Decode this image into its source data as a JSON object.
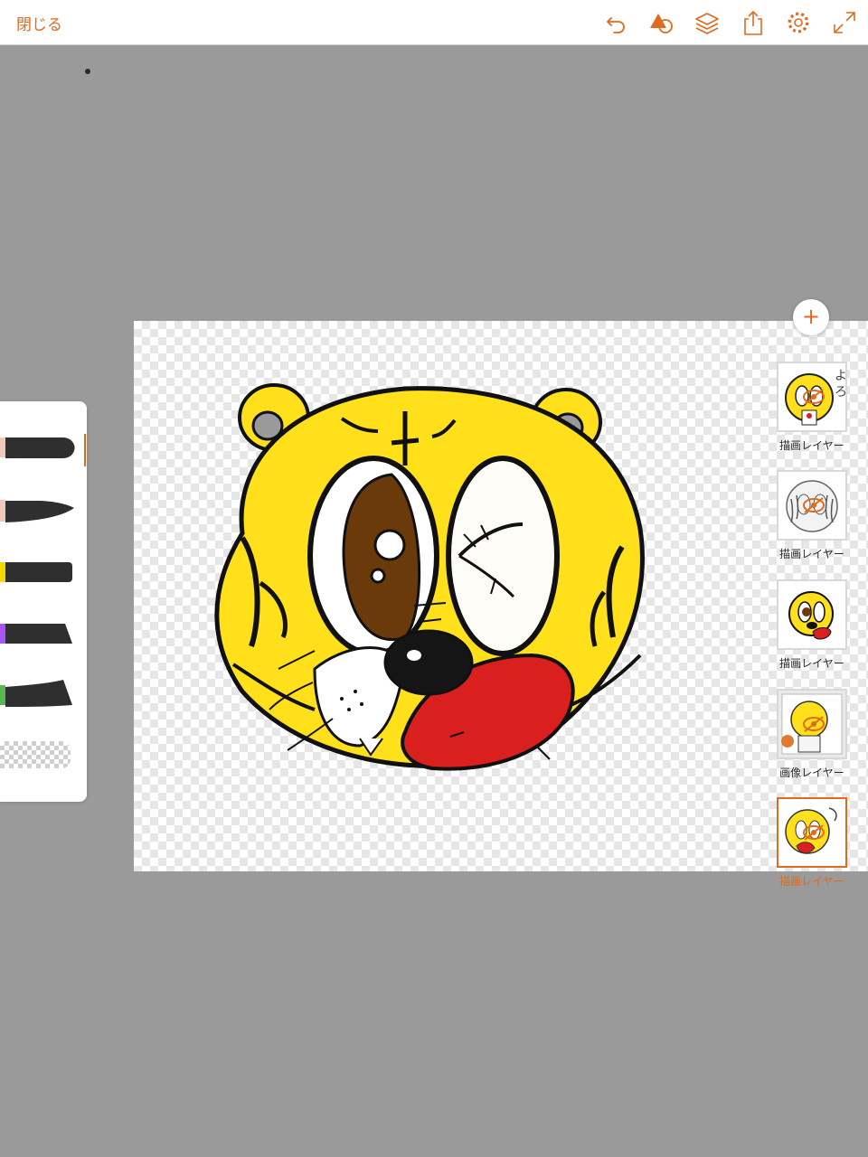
{
  "topbar": {
    "close_label": "閉じる",
    "tools": [
      {
        "icon": "undo-icon"
      },
      {
        "icon": "shapes-icon"
      },
      {
        "icon": "layers-icon"
      },
      {
        "icon": "share-icon"
      },
      {
        "icon": "gear-icon"
      },
      {
        "icon": "fullscreen-icon"
      }
    ]
  },
  "colors": {
    "accent": "#e06a1e",
    "background": "#9a9a9a",
    "tiger_yellow": "#ffe01a",
    "eye_brown": "#6b3a0a",
    "tongue_red": "#d9201f"
  },
  "brushes": [
    {
      "name": "round-brush",
      "swatch": "#f2c9b8"
    },
    {
      "name": "tapered-brush",
      "swatch": "#f2c9b8"
    },
    {
      "name": "flat-brush",
      "swatch": "#f5d800"
    },
    {
      "name": "chisel-brush",
      "swatch": "#a855f7"
    },
    {
      "name": "fan-brush",
      "swatch": "#5bb850"
    }
  ],
  "layers": {
    "add_label": "+",
    "items": [
      {
        "label": "描画レイヤー",
        "visible": false,
        "selected": false
      },
      {
        "label": "描画レイヤー",
        "visible": false,
        "selected": false
      },
      {
        "label": "描画レイヤー",
        "visible": true,
        "selected": false
      },
      {
        "label": "画像レイヤー",
        "visible": false,
        "selected": false
      },
      {
        "label": "描画レイヤー",
        "visible": false,
        "selected": true
      }
    ]
  }
}
